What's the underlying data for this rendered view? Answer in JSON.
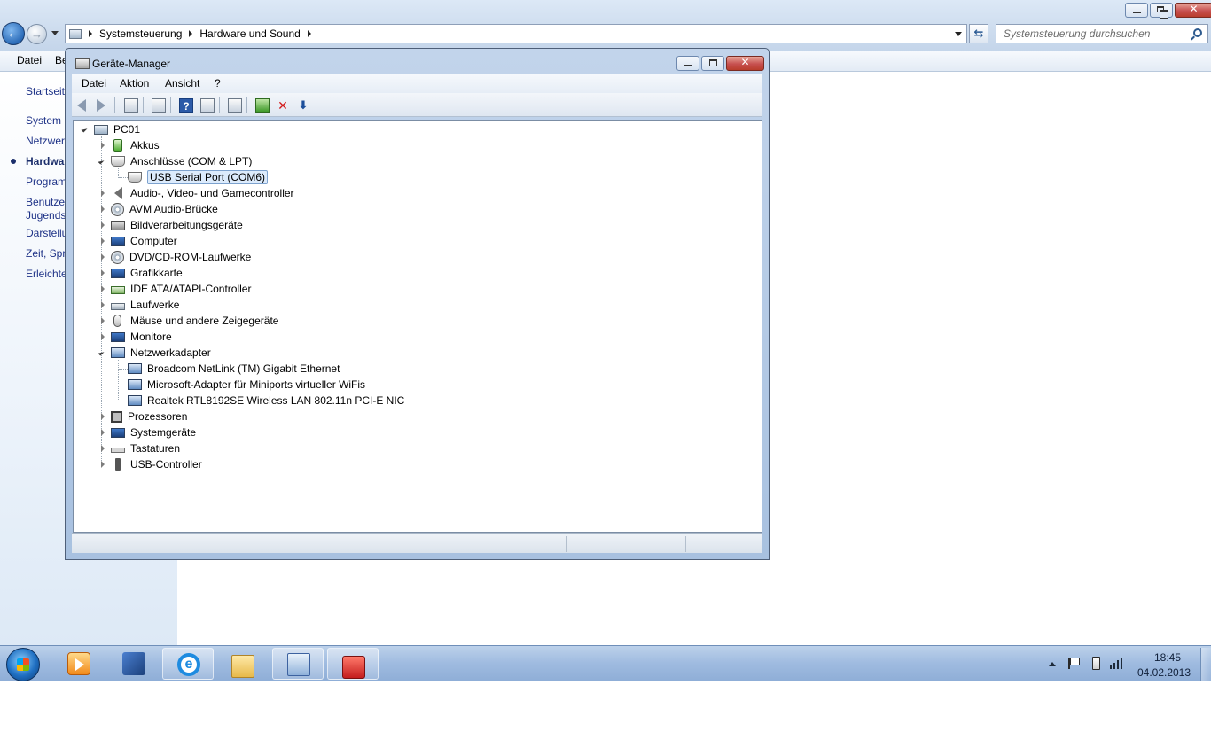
{
  "explorer": {
    "breadcrumb": [
      "Systemsteuerung",
      "Hardware und Sound"
    ],
    "search_placeholder": "Systemsteuerung durchsuchen",
    "menu": [
      "Datei",
      "Be"
    ],
    "sidebar": [
      {
        "label": "Startseite"
      },
      {
        "label": "System u"
      },
      {
        "label": "Netzwer"
      },
      {
        "label": "Hardwa",
        "active": true
      },
      {
        "label": "Program"
      },
      {
        "label": "Benutzer"
      },
      {
        "label": "Jugends"
      },
      {
        "label": "Darstellu"
      },
      {
        "label": "Zeit, Spr"
      },
      {
        "label": "Erleichte"
      }
    ]
  },
  "devmgr": {
    "title": "Geräte-Manager",
    "menu": [
      "Datei",
      "Aktion",
      "Ansicht",
      "?"
    ],
    "toolbar_icons": [
      "back-icon",
      "forward-icon",
      "show-hide-tree-icon",
      "properties-icon",
      "help-icon",
      "view-icon",
      "scan-hardware-icon",
      "update-driver-icon",
      "uninstall-icon",
      "disable-icon"
    ],
    "tree": {
      "root": "PC01",
      "nodes": [
        {
          "label": "Akkus",
          "icon": "battery-icon",
          "state": "collapsed"
        },
        {
          "label": "Anschlüsse (COM & LPT)",
          "icon": "port-icon",
          "state": "expanded",
          "children": [
            {
              "label": "USB Serial Port (COM6)",
              "icon": "port-icon",
              "selected": true
            }
          ]
        },
        {
          "label": "Audio-, Video- und Gamecontroller",
          "icon": "speaker-icon",
          "state": "collapsed"
        },
        {
          "label": "AVM Audio-Brücke",
          "icon": "audio-bridge-icon",
          "state": "collapsed"
        },
        {
          "label": "Bildverarbeitungsgeräte",
          "icon": "camera-icon",
          "state": "collapsed"
        },
        {
          "label": "Computer",
          "icon": "computer-icon",
          "state": "collapsed"
        },
        {
          "label": "DVD/CD-ROM-Laufwerke",
          "icon": "dvd-drive-icon",
          "state": "collapsed"
        },
        {
          "label": "Grafikkarte",
          "icon": "display-adapter-icon",
          "state": "collapsed"
        },
        {
          "label": "IDE ATA/ATAPI-Controller",
          "icon": "ide-controller-icon",
          "state": "collapsed"
        },
        {
          "label": "Laufwerke",
          "icon": "disk-drive-icon",
          "state": "collapsed"
        },
        {
          "label": "Mäuse und andere Zeigegeräte",
          "icon": "mouse-icon",
          "state": "collapsed"
        },
        {
          "label": "Monitore",
          "icon": "monitor-icon",
          "state": "collapsed"
        },
        {
          "label": "Netzwerkadapter",
          "icon": "network-adapter-icon",
          "state": "expanded",
          "children": [
            {
              "label": "Broadcom NetLink (TM) Gigabit Ethernet",
              "icon": "network-adapter-icon"
            },
            {
              "label": "Microsoft-Adapter für Miniports virtueller WiFis",
              "icon": "network-adapter-icon"
            },
            {
              "label": "Realtek RTL8192SE Wireless LAN 802.11n PCI-E NIC",
              "icon": "network-adapter-icon"
            }
          ]
        },
        {
          "label": "Prozessoren",
          "icon": "processor-icon",
          "state": "collapsed"
        },
        {
          "label": "Systemgeräte",
          "icon": "system-device-icon",
          "state": "collapsed"
        },
        {
          "label": "Tastaturen",
          "icon": "keyboard-icon",
          "state": "collapsed"
        },
        {
          "label": "USB-Controller",
          "icon": "usb-icon",
          "state": "collapsed"
        }
      ]
    }
  },
  "taskbar": {
    "apps": [
      {
        "name": "media-player-icon",
        "pinned": false
      },
      {
        "name": "tools-icon",
        "pinned": false
      },
      {
        "name": "internet-explorer-icon",
        "pinned": true
      },
      {
        "name": "file-explorer-icon",
        "pinned": false
      },
      {
        "name": "control-panel-icon",
        "pinned": true
      },
      {
        "name": "toolbox-icon",
        "pinned": true
      }
    ],
    "clock_time": "18:45",
    "clock_date": "04.02.2013"
  },
  "colors": {
    "taskbar": "#9fbbe0",
    "window_frame": "#a8c1e0",
    "selection": "#dcebfc",
    "link_text": "#1e3287"
  }
}
